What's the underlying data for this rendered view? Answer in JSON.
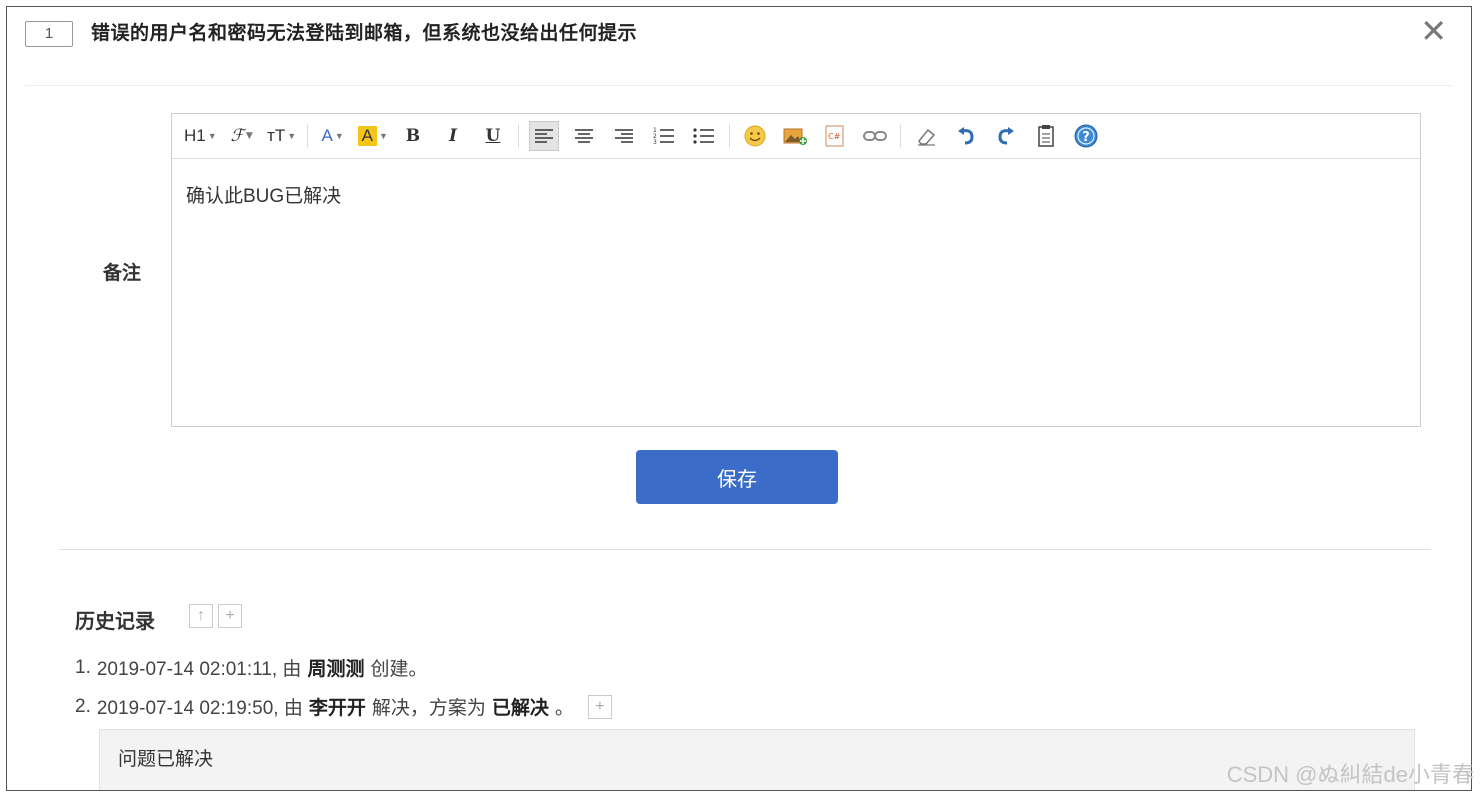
{
  "header": {
    "id": "1",
    "title": "错误的用户名和密码无法登陆到邮箱，但系统也没给出任何提示"
  },
  "form": {
    "remark_label": "备注",
    "editor_content": "确认此BUG已解决",
    "save_label": "保存"
  },
  "toolbar": {
    "heading": "H1",
    "font_family": "ℱ",
    "font_size": "ᴛT",
    "font_color": "A",
    "bg_color": "A",
    "bold": "B",
    "italic": "I",
    "underline": "U"
  },
  "history": {
    "title": "历史记录",
    "entries": [
      {
        "num": "1.",
        "time": "2019-07-14 02:01:11, 由",
        "user": "周测测",
        "action": "创建。"
      },
      {
        "num": "2.",
        "time": "2019-07-14 02:19:50, 由",
        "user": "李开开",
        "action": "解决，方案为",
        "resolution": "已解决",
        "end": "。"
      }
    ],
    "comment": "问题已解决"
  },
  "watermark": "CSDN @ぬ糾結de小青春",
  "colors": {
    "accent": "#3b6cc7",
    "highlight": "#f5c518"
  }
}
